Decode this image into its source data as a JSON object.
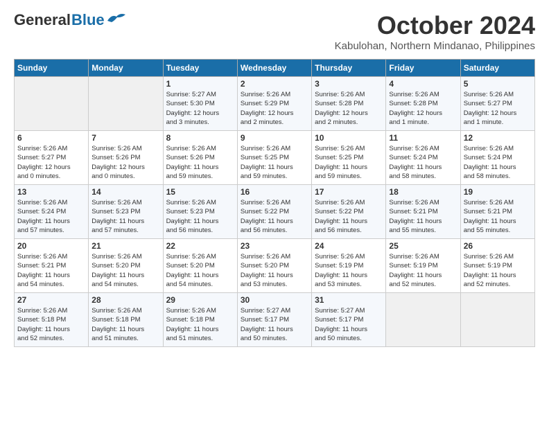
{
  "logo": {
    "general": "General",
    "blue": "Blue"
  },
  "header": {
    "month": "October 2024",
    "location": "Kabulohan, Northern Mindanao, Philippines"
  },
  "weekdays": [
    "Sunday",
    "Monday",
    "Tuesday",
    "Wednesday",
    "Thursday",
    "Friday",
    "Saturday"
  ],
  "weeks": [
    [
      {
        "day": "",
        "info": ""
      },
      {
        "day": "",
        "info": ""
      },
      {
        "day": "1",
        "info": "Sunrise: 5:27 AM\nSunset: 5:30 PM\nDaylight: 12 hours\nand 3 minutes."
      },
      {
        "day": "2",
        "info": "Sunrise: 5:26 AM\nSunset: 5:29 PM\nDaylight: 12 hours\nand 2 minutes."
      },
      {
        "day": "3",
        "info": "Sunrise: 5:26 AM\nSunset: 5:28 PM\nDaylight: 12 hours\nand 2 minutes."
      },
      {
        "day": "4",
        "info": "Sunrise: 5:26 AM\nSunset: 5:28 PM\nDaylight: 12 hours\nand 1 minute."
      },
      {
        "day": "5",
        "info": "Sunrise: 5:26 AM\nSunset: 5:27 PM\nDaylight: 12 hours\nand 1 minute."
      }
    ],
    [
      {
        "day": "6",
        "info": "Sunrise: 5:26 AM\nSunset: 5:27 PM\nDaylight: 12 hours\nand 0 minutes."
      },
      {
        "day": "7",
        "info": "Sunrise: 5:26 AM\nSunset: 5:26 PM\nDaylight: 12 hours\nand 0 minutes."
      },
      {
        "day": "8",
        "info": "Sunrise: 5:26 AM\nSunset: 5:26 PM\nDaylight: 11 hours\nand 59 minutes."
      },
      {
        "day": "9",
        "info": "Sunrise: 5:26 AM\nSunset: 5:25 PM\nDaylight: 11 hours\nand 59 minutes."
      },
      {
        "day": "10",
        "info": "Sunrise: 5:26 AM\nSunset: 5:25 PM\nDaylight: 11 hours\nand 59 minutes."
      },
      {
        "day": "11",
        "info": "Sunrise: 5:26 AM\nSunset: 5:24 PM\nDaylight: 11 hours\nand 58 minutes."
      },
      {
        "day": "12",
        "info": "Sunrise: 5:26 AM\nSunset: 5:24 PM\nDaylight: 11 hours\nand 58 minutes."
      }
    ],
    [
      {
        "day": "13",
        "info": "Sunrise: 5:26 AM\nSunset: 5:24 PM\nDaylight: 11 hours\nand 57 minutes."
      },
      {
        "day": "14",
        "info": "Sunrise: 5:26 AM\nSunset: 5:23 PM\nDaylight: 11 hours\nand 57 minutes."
      },
      {
        "day": "15",
        "info": "Sunrise: 5:26 AM\nSunset: 5:23 PM\nDaylight: 11 hours\nand 56 minutes."
      },
      {
        "day": "16",
        "info": "Sunrise: 5:26 AM\nSunset: 5:22 PM\nDaylight: 11 hours\nand 56 minutes."
      },
      {
        "day": "17",
        "info": "Sunrise: 5:26 AM\nSunset: 5:22 PM\nDaylight: 11 hours\nand 56 minutes."
      },
      {
        "day": "18",
        "info": "Sunrise: 5:26 AM\nSunset: 5:21 PM\nDaylight: 11 hours\nand 55 minutes."
      },
      {
        "day": "19",
        "info": "Sunrise: 5:26 AM\nSunset: 5:21 PM\nDaylight: 11 hours\nand 55 minutes."
      }
    ],
    [
      {
        "day": "20",
        "info": "Sunrise: 5:26 AM\nSunset: 5:21 PM\nDaylight: 11 hours\nand 54 minutes."
      },
      {
        "day": "21",
        "info": "Sunrise: 5:26 AM\nSunset: 5:20 PM\nDaylight: 11 hours\nand 54 minutes."
      },
      {
        "day": "22",
        "info": "Sunrise: 5:26 AM\nSunset: 5:20 PM\nDaylight: 11 hours\nand 54 minutes."
      },
      {
        "day": "23",
        "info": "Sunrise: 5:26 AM\nSunset: 5:20 PM\nDaylight: 11 hours\nand 53 minutes."
      },
      {
        "day": "24",
        "info": "Sunrise: 5:26 AM\nSunset: 5:19 PM\nDaylight: 11 hours\nand 53 minutes."
      },
      {
        "day": "25",
        "info": "Sunrise: 5:26 AM\nSunset: 5:19 PM\nDaylight: 11 hours\nand 52 minutes."
      },
      {
        "day": "26",
        "info": "Sunrise: 5:26 AM\nSunset: 5:19 PM\nDaylight: 11 hours\nand 52 minutes."
      }
    ],
    [
      {
        "day": "27",
        "info": "Sunrise: 5:26 AM\nSunset: 5:18 PM\nDaylight: 11 hours\nand 52 minutes."
      },
      {
        "day": "28",
        "info": "Sunrise: 5:26 AM\nSunset: 5:18 PM\nDaylight: 11 hours\nand 51 minutes."
      },
      {
        "day": "29",
        "info": "Sunrise: 5:26 AM\nSunset: 5:18 PM\nDaylight: 11 hours\nand 51 minutes."
      },
      {
        "day": "30",
        "info": "Sunrise: 5:27 AM\nSunset: 5:17 PM\nDaylight: 11 hours\nand 50 minutes."
      },
      {
        "day": "31",
        "info": "Sunrise: 5:27 AM\nSunset: 5:17 PM\nDaylight: 11 hours\nand 50 minutes."
      },
      {
        "day": "",
        "info": ""
      },
      {
        "day": "",
        "info": ""
      }
    ]
  ]
}
